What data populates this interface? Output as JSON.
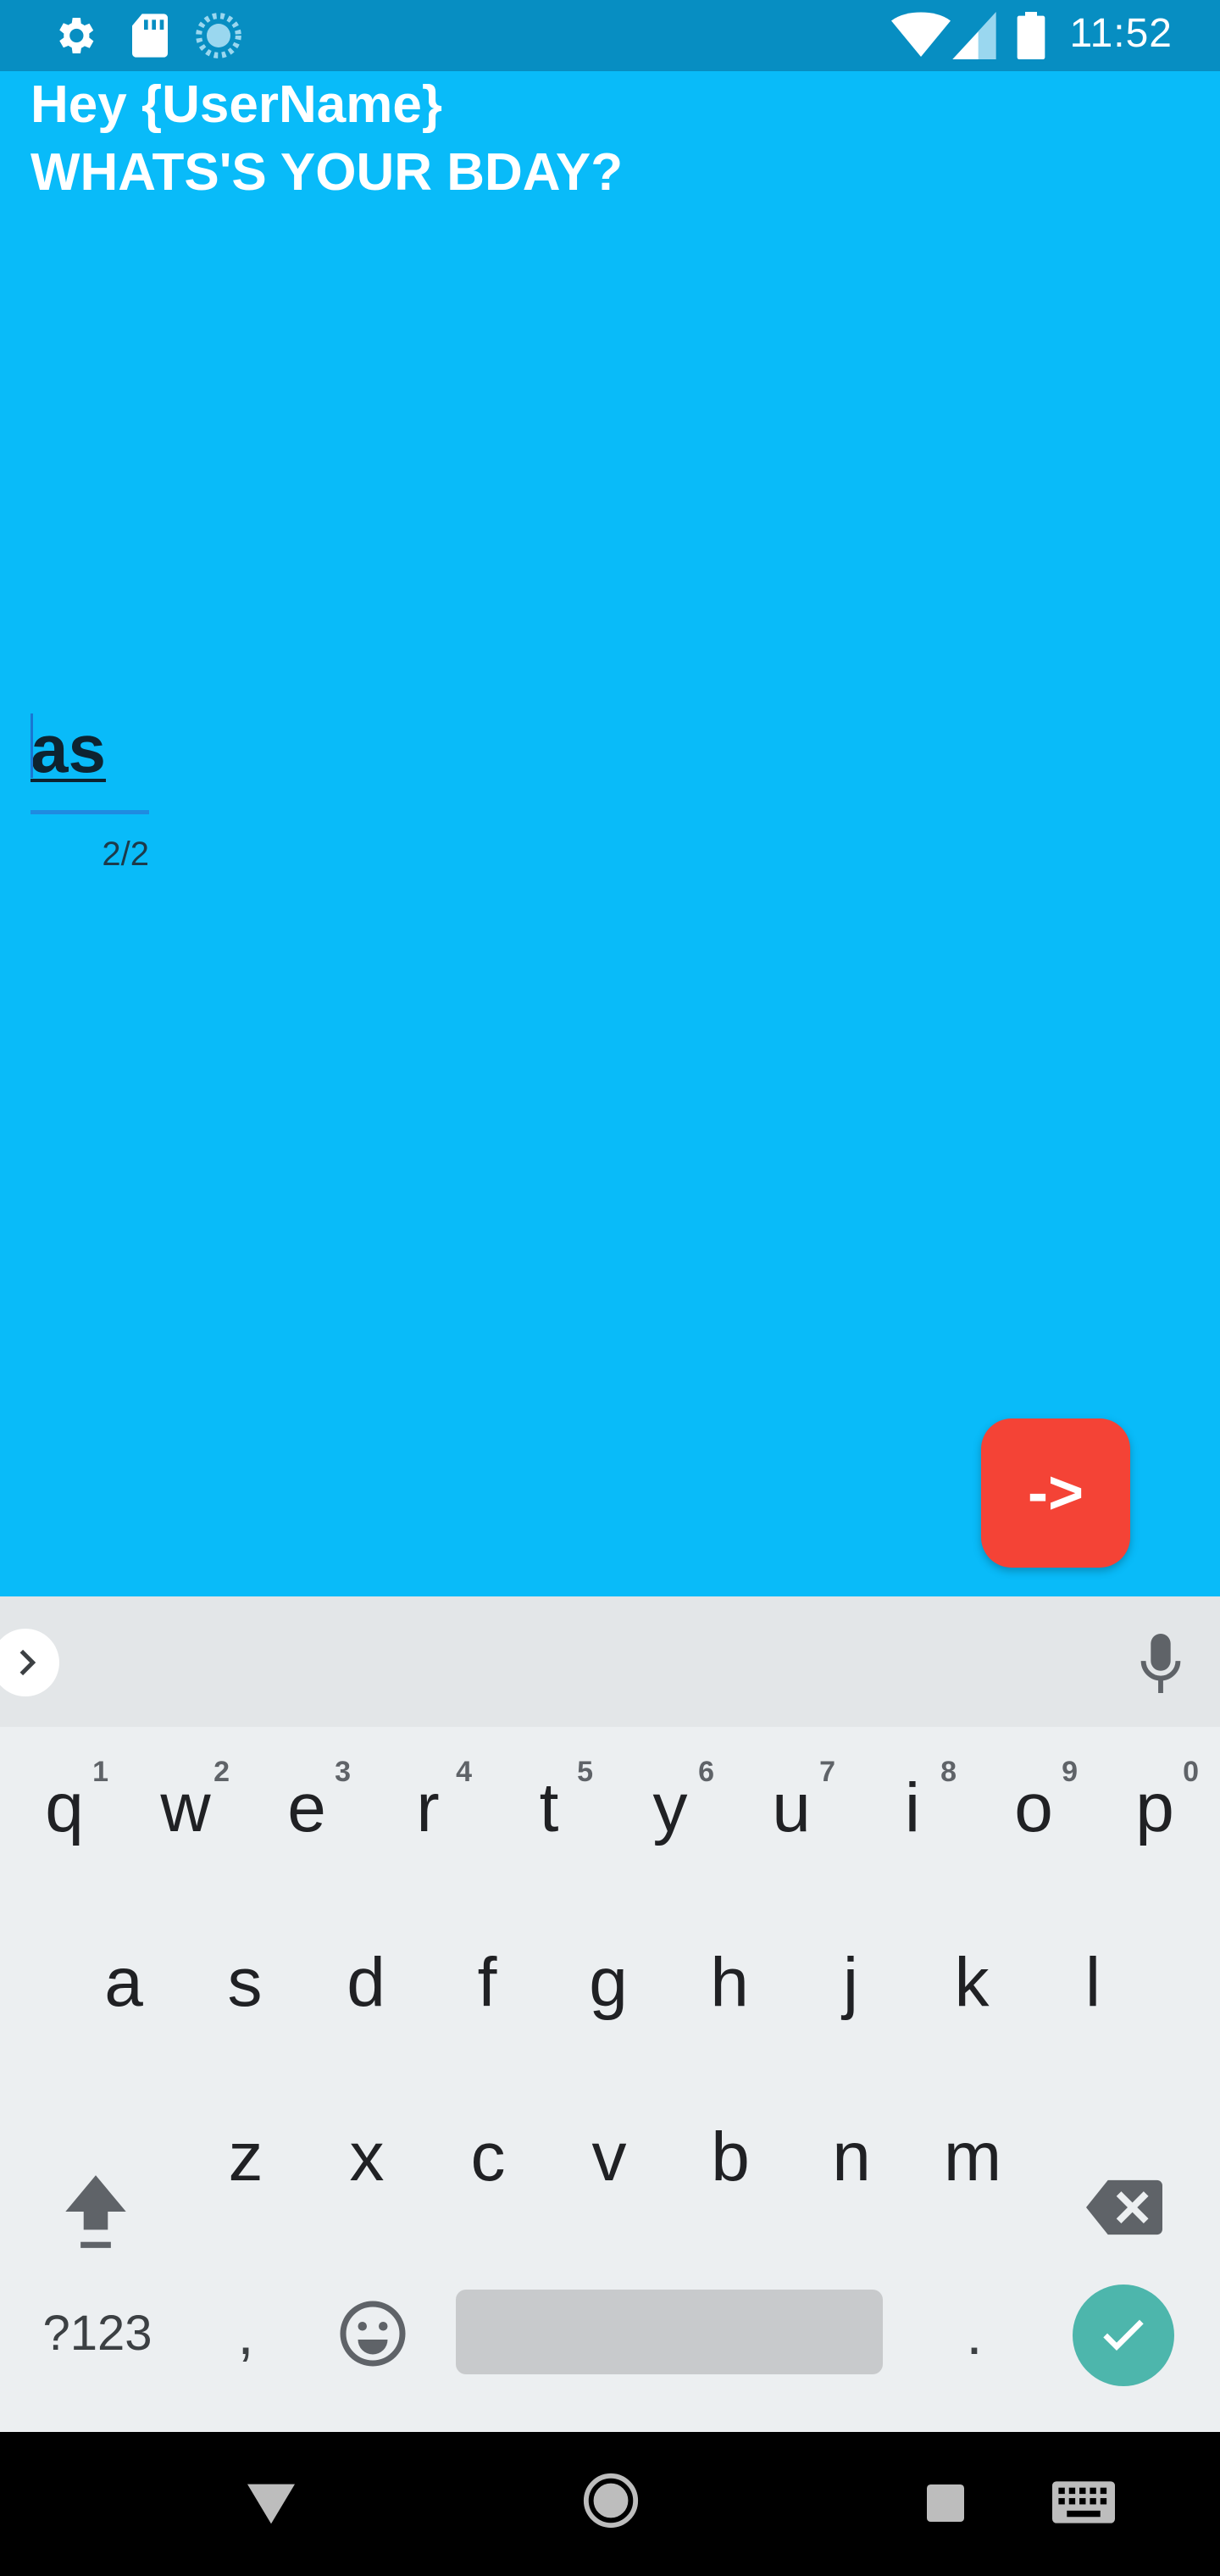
{
  "status_bar": {
    "time": "11:52",
    "icons": [
      "settings-icon",
      "sd-card-icon",
      "sync-icon",
      "wifi-icon",
      "cell-signal-icon",
      "battery-icon"
    ]
  },
  "screen": {
    "background": "#09bbf9",
    "greeting_line1": "Hey {UserName}",
    "greeting_line2": "WHATS'S YOUR BDAY?",
    "input_value": "as",
    "char_counter": "2/2",
    "next_button_label": "->",
    "next_button_color": "#f44336"
  },
  "keyboard": {
    "row1": [
      {
        "key": "q",
        "hint": "1"
      },
      {
        "key": "w",
        "hint": "2"
      },
      {
        "key": "e",
        "hint": "3"
      },
      {
        "key": "r",
        "hint": "4"
      },
      {
        "key": "t",
        "hint": "5"
      },
      {
        "key": "y",
        "hint": "6"
      },
      {
        "key": "u",
        "hint": "7"
      },
      {
        "key": "i",
        "hint": "8"
      },
      {
        "key": "o",
        "hint": "9"
      },
      {
        "key": "p",
        "hint": "0"
      }
    ],
    "row2": [
      "a",
      "s",
      "d",
      "f",
      "g",
      "h",
      "j",
      "k",
      "l"
    ],
    "row3": [
      "z",
      "x",
      "c",
      "v",
      "b",
      "n",
      "m"
    ],
    "symbols_label": "?123",
    "comma": ",",
    "period": ".",
    "enter_color": "#4db6ac",
    "icons": [
      "expand-icon",
      "mic-icon",
      "shift-icon",
      "backspace-icon",
      "emoji-icon",
      "checkmark-icon"
    ]
  },
  "nav_bar": {
    "icons": [
      "back-icon",
      "home-icon",
      "recents-icon",
      "keyboard-switch-icon"
    ]
  }
}
